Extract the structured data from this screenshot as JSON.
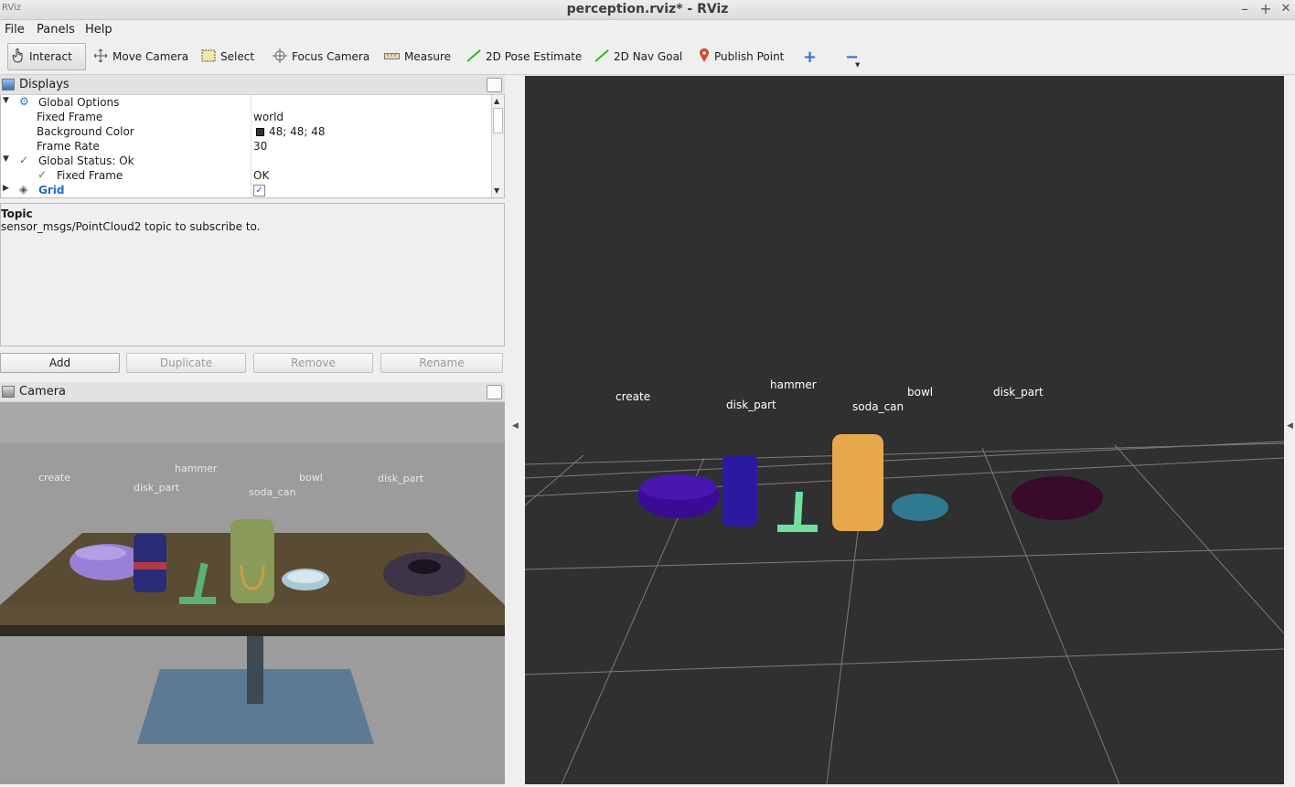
{
  "window": {
    "title": "perception.rviz* - RViz",
    "minimize": "–",
    "maximize": "+",
    "close": "✕"
  },
  "menu": [
    "File",
    "Panels",
    "Help"
  ],
  "toolbar": {
    "interact": "Interact",
    "move_camera": "Move Camera",
    "select": "Select",
    "focus_camera": "Focus Camera",
    "measure": "Measure",
    "pose_estimate": "2D Pose Estimate",
    "nav_goal": "2D Nav Goal",
    "publish_point": "Publish Point",
    "add_tool": "+",
    "remove_tool": "−"
  },
  "displays": {
    "title": "Displays",
    "rows": [
      {
        "name": "Global Options",
        "value": ""
      },
      {
        "name": "Fixed Frame",
        "value": "world"
      },
      {
        "name": "Background Color",
        "value": "48; 48; 48"
      },
      {
        "name": "Frame Rate",
        "value": "30"
      },
      {
        "name": "Global Status: Ok",
        "value": ""
      },
      {
        "name": "Fixed Frame",
        "value": "OK"
      },
      {
        "name": "Grid",
        "value": ""
      }
    ],
    "background_color_hex": "#303030"
  },
  "description": {
    "title": "Topic",
    "text": "sensor_msgs/PointCloud2 topic to subscribe to."
  },
  "buttons": {
    "add": "Add",
    "duplicate": "Duplicate",
    "remove": "Remove",
    "rename": "Rename"
  },
  "camera": {
    "title": "Camera",
    "labels": [
      "create",
      "disk_part",
      "hammer",
      "soda_can",
      "bowl",
      "disk_part"
    ]
  },
  "viewport": {
    "labels": [
      "create",
      "disk_part",
      "hammer",
      "soda_can",
      "bowl",
      "disk_part"
    ]
  },
  "colors": {
    "create_cloud": "#3a0b96",
    "disk_part_cloud": "#2a1aa0",
    "hammer_cloud": "#6fe0a0",
    "soda_can_cloud": "#e6a84a",
    "bowl_cloud": "#2f7a90",
    "disk_part2_cloud": "#3a0a2a"
  }
}
